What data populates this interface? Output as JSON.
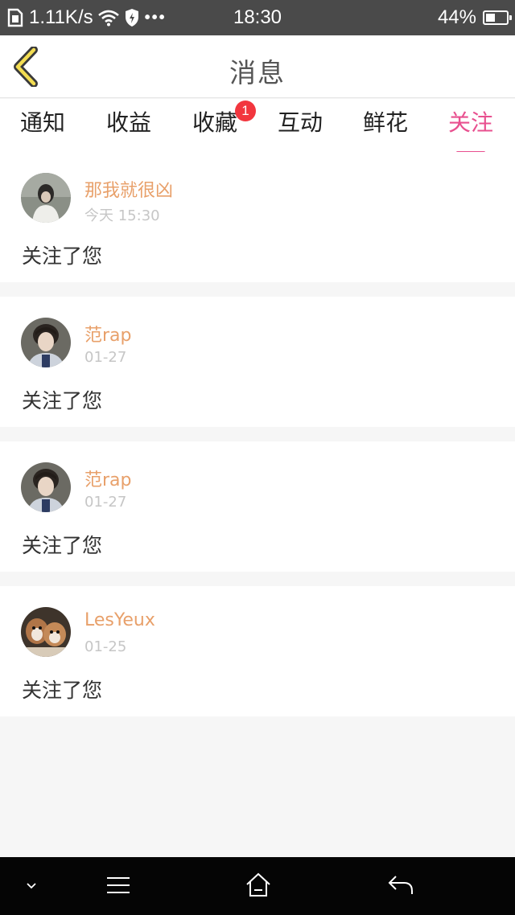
{
  "status_bar": {
    "speed": "1.11K/s",
    "time": "18:30",
    "battery": "44%",
    "battery_level": 0.44,
    "dots": "•••",
    "icons": [
      "sim-icon",
      "wifi-icon",
      "shield-icon",
      "battery-icon"
    ]
  },
  "header": {
    "title": "消息",
    "back_icon": "chevron-left-icon"
  },
  "tabs": [
    {
      "label": "通知"
    },
    {
      "label": "收益"
    },
    {
      "label": "收藏",
      "badge": "1"
    },
    {
      "label": "互动"
    },
    {
      "label": "鲜花"
    },
    {
      "label": "关注",
      "active": true
    }
  ],
  "notifications": [
    {
      "name": "那我就很凶",
      "time": "今天 15:30",
      "message": "关注了您"
    },
    {
      "name": "范rap",
      "time": "01-27",
      "message": "关注了您"
    },
    {
      "name": "范rap",
      "time": "01-27",
      "message": "关注了您"
    },
    {
      "name": "LesYeux",
      "time": "01-25",
      "message": "关注了您"
    }
  ],
  "colors": {
    "accent": "#e8508f",
    "username": "#e8a06a",
    "badge": "#f2363e",
    "status_bar": "#4a4a4a",
    "nav_bar": "#050505"
  },
  "nav_bar": {
    "icons": [
      "chevron-down-icon",
      "menu-icon",
      "home-icon",
      "back-arrow-icon"
    ]
  }
}
